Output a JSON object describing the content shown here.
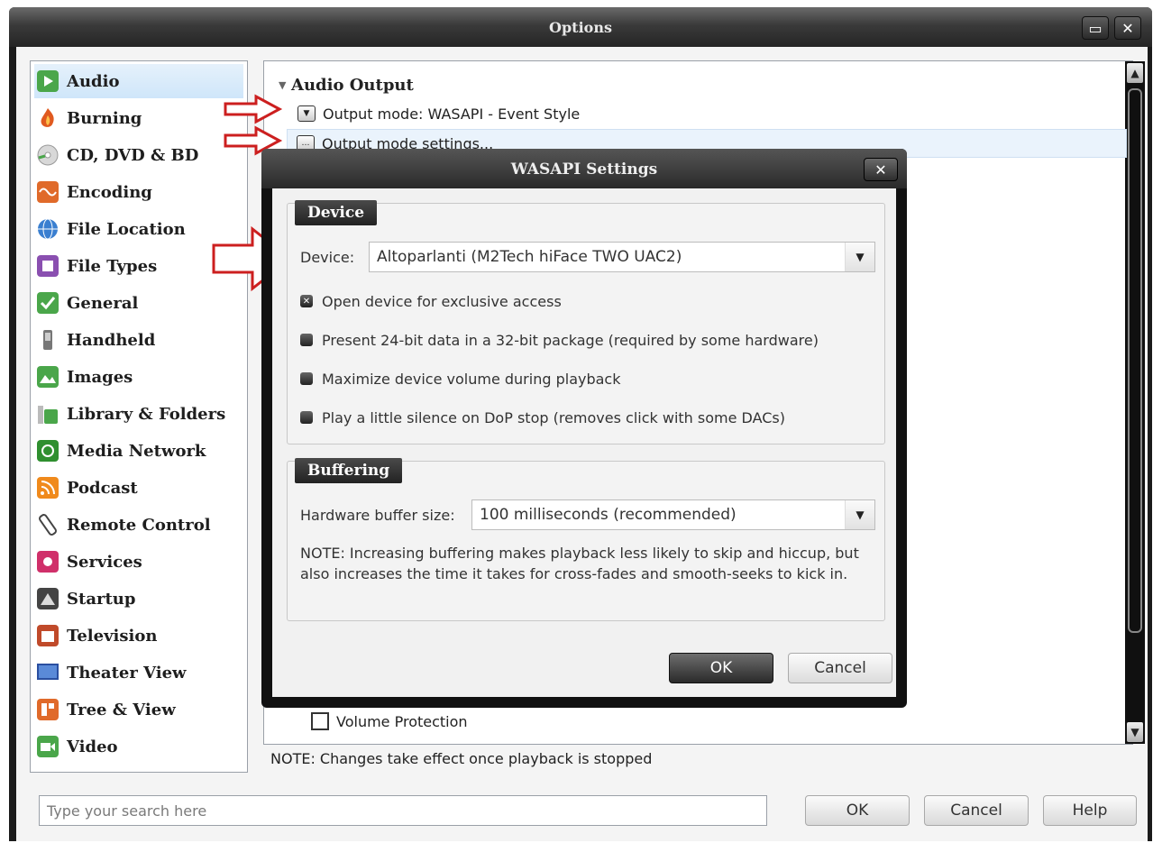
{
  "window": {
    "title": "Options"
  },
  "sidebar": {
    "items": [
      {
        "label": "Audio",
        "icon": "audio-icon",
        "color": "#4aa64a"
      },
      {
        "label": "Burning",
        "icon": "burning-icon",
        "color": "#e05a1f"
      },
      {
        "label": "CD, DVD & BD",
        "icon": "disc-icon",
        "color": "#b0b0b0"
      },
      {
        "label": "Encoding",
        "icon": "encoding-icon",
        "color": "#e06a2a"
      },
      {
        "label": "File Location",
        "icon": "globe-icon",
        "color": "#3a7fd0"
      },
      {
        "label": "File Types",
        "icon": "puzzle-icon",
        "color": "#8a4fb0"
      },
      {
        "label": "General",
        "icon": "general-icon",
        "color": "#4aa64a"
      },
      {
        "label": "Handheld",
        "icon": "handheld-icon",
        "color": "#666666"
      },
      {
        "label": "Images",
        "icon": "images-icon",
        "color": "#4aa64a"
      },
      {
        "label": "Library & Folders",
        "icon": "library-icon",
        "color": "#4aa64a"
      },
      {
        "label": "Media Network",
        "icon": "network-icon",
        "color": "#2f8f2f"
      },
      {
        "label": "Podcast",
        "icon": "rss-icon",
        "color": "#f08a1c"
      },
      {
        "label": "Remote Control",
        "icon": "remote-icon",
        "color": "#555555"
      },
      {
        "label": "Services",
        "icon": "services-icon",
        "color": "#d0306a"
      },
      {
        "label": "Startup",
        "icon": "startup-icon",
        "color": "#444444"
      },
      {
        "label": "Television",
        "icon": "tv-icon",
        "color": "#c04a2a"
      },
      {
        "label": "Theater View",
        "icon": "theater-icon",
        "color": "#2a4fa0"
      },
      {
        "label": "Tree & View",
        "icon": "tree-icon",
        "color": "#e06a2a"
      },
      {
        "label": "Video",
        "icon": "video-icon",
        "color": "#4aa64a"
      }
    ]
  },
  "panel": {
    "section_title": "Audio Output",
    "output_mode": "Output mode: WASAPI - Event Style",
    "output_mode_settings": "Output mode settings...",
    "volume_protection": "Volume Protection",
    "note": "NOTE: Changes take effect once playback is stopped"
  },
  "search": {
    "placeholder": "Type your search here"
  },
  "buttons": {
    "ok": "OK",
    "cancel": "Cancel",
    "help": "Help"
  },
  "dialog": {
    "title": "WASAPI Settings",
    "device_group": "Device",
    "device_label": "Device:",
    "device_value": "Altoparlanti (M2Tech hiFace TWO UAC2)",
    "options": [
      {
        "label": "Open device for exclusive access",
        "checked": true
      },
      {
        "label": "Present 24-bit data in a 32-bit package (required by some hardware)",
        "checked": false
      },
      {
        "label": "Maximize device volume during playback",
        "checked": false
      },
      {
        "label": "Play a little silence on DoP stop (removes click with some DACs)",
        "checked": false
      }
    ],
    "buffering_group": "Buffering",
    "buffer_label": "Hardware buffer size:",
    "buffer_value": "100 milliseconds (recommended)",
    "buffer_note": "NOTE: Increasing buffering makes playback less likely to skip and hiccup, but also increases the time it takes for cross-fades and smooth-seeks to kick in.",
    "ok": "OK",
    "cancel": "Cancel"
  },
  "colors": {
    "accent": "#cc1f1f",
    "selection": "#cfe6fa"
  }
}
